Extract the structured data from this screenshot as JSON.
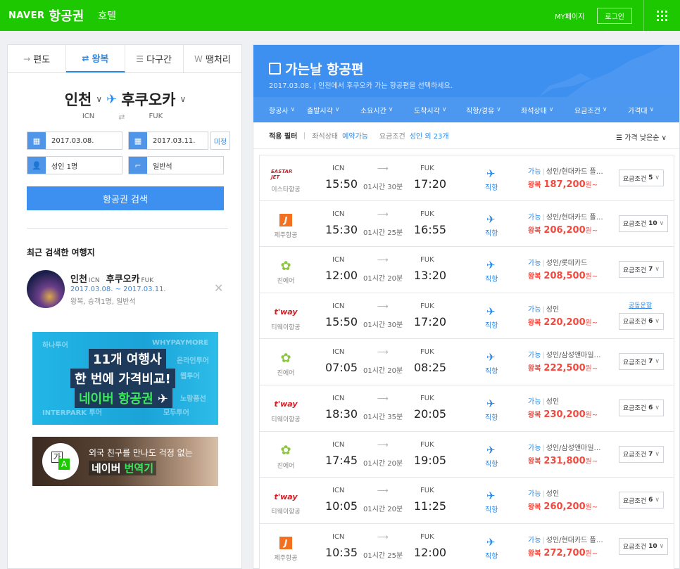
{
  "topbar": {
    "brand": "NAVER",
    "service": "항공권",
    "hotel": "호텔",
    "mypage": "MY페이지",
    "login": "로그인"
  },
  "left": {
    "tabs": [
      {
        "icon": "→",
        "label": "편도"
      },
      {
        "icon": "⇄",
        "label": "왕복"
      },
      {
        "icon": "☰",
        "label": "다구간"
      },
      {
        "icon": "W",
        "label": "땡처리"
      }
    ],
    "route": {
      "from": "인천",
      "from_code": "ICN",
      "to": "후쿠오카",
      "to_code": "FUK"
    },
    "depart_date": "2017.03.08.",
    "return_date": "2017.03.11.",
    "undecided": "미정",
    "passengers": "성인 1명",
    "seat_class": "일반석",
    "search_button": "항공권 검색",
    "recent_title": "최근 검색한 여행지",
    "recent": {
      "from": "인천",
      "from_code": "ICN",
      "to": "후쿠오카",
      "to_code": "FUK",
      "dates": "2017.03.08. ~ 2017.03.11.",
      "info": "왕복, 승객1명, 일반석"
    },
    "banner1": {
      "bg_texts": [
        "하나투어",
        "WHYPAYMORE",
        "온라인투어",
        "INTERPARK 투어",
        "모두투어",
        "웹투어",
        "노랑풍선"
      ],
      "line1": "11개 여행사",
      "line2": "한 번에 가격비교!",
      "line3_a": "네이버 ",
      "line3_b": "항공권"
    },
    "banner2": {
      "ga": "가",
      "a": "A",
      "line1": "외국 친구를 만나도 걱정 없는",
      "line2_a": "네이버 ",
      "line2_b": "번역기"
    }
  },
  "right": {
    "title": "가는날 항공편",
    "subtitle": "2017.03.08.  |  인천에서 후쿠오카 가는 항공편을 선택하세요.",
    "filters": [
      "항공사",
      "출발시각",
      "소요시간",
      "도착시각",
      "직항/경유",
      "좌석상태",
      "요금조건",
      "가격대"
    ],
    "applied_label": "적용 필터",
    "applied": [
      {
        "k": "좌석상태",
        "v": "예약가능"
      },
      {
        "k": "요금조건",
        "v": "성인 외 23개"
      }
    ],
    "sort": "가격 낮은순",
    "flights": [
      {
        "airline": "이스타항공",
        "logo": "EASTAR JET",
        "logo_type": "eastar",
        "dep_code": "ICN",
        "dep": "15:50",
        "dur": "01시간 30분",
        "arr_code": "FUK",
        "arr": "17:20",
        "stop": "직항",
        "status": "가능",
        "cond": "성인/현대카드 플…",
        "trip": "왕복",
        "price": "187,200",
        "won": "원~",
        "fare_label": "요금조건",
        "fare_count": "5",
        "share": ""
      },
      {
        "airline": "제주항공",
        "logo": "J",
        "logo_type": "jeju",
        "dep_code": "ICN",
        "dep": "15:30",
        "dur": "01시간 25분",
        "arr_code": "FUK",
        "arr": "16:55",
        "stop": "직항",
        "status": "가능",
        "cond": "성인/현대카드 플…",
        "trip": "왕복",
        "price": "206,200",
        "won": "원~",
        "fare_label": "요금조건",
        "fare_count": "10",
        "share": ""
      },
      {
        "airline": "진에어",
        "logo": "✿",
        "logo_type": "jin",
        "dep_code": "ICN",
        "dep": "12:00",
        "dur": "01시간 20분",
        "arr_code": "FUK",
        "arr": "13:20",
        "stop": "직항",
        "status": "가능",
        "cond": "성인/롯데카드",
        "trip": "왕복",
        "price": "208,500",
        "won": "원~",
        "fare_label": "요금조건",
        "fare_count": "7",
        "share": ""
      },
      {
        "airline": "티웨이항공",
        "logo": "t'way",
        "logo_type": "tway",
        "dep_code": "ICN",
        "dep": "15:50",
        "dur": "01시간 30분",
        "arr_code": "FUK",
        "arr": "17:20",
        "stop": "직항",
        "status": "가능",
        "cond": "성인",
        "trip": "왕복",
        "price": "220,200",
        "won": "원~",
        "fare_label": "요금조건",
        "fare_count": "6",
        "share": "공동운항"
      },
      {
        "airline": "진에어",
        "logo": "✿",
        "logo_type": "jin",
        "dep_code": "ICN",
        "dep": "07:05",
        "dur": "01시간 20분",
        "arr_code": "FUK",
        "arr": "08:25",
        "stop": "직항",
        "status": "가능",
        "cond": "성인/삼성앤마일…",
        "trip": "왕복",
        "price": "222,500",
        "won": "원~",
        "fare_label": "요금조건",
        "fare_count": "7",
        "share": ""
      },
      {
        "airline": "티웨이항공",
        "logo": "t'way",
        "logo_type": "tway",
        "dep_code": "ICN",
        "dep": "18:30",
        "dur": "01시간 35분",
        "arr_code": "FUK",
        "arr": "20:05",
        "stop": "직항",
        "status": "가능",
        "cond": "성인",
        "trip": "왕복",
        "price": "230,200",
        "won": "원~",
        "fare_label": "요금조건",
        "fare_count": "6",
        "share": ""
      },
      {
        "airline": "진에어",
        "logo": "✿",
        "logo_type": "jin",
        "dep_code": "ICN",
        "dep": "17:45",
        "dur": "01시간 20분",
        "arr_code": "FUK",
        "arr": "19:05",
        "stop": "직항",
        "status": "가능",
        "cond": "성인/삼성앤마일…",
        "trip": "왕복",
        "price": "231,800",
        "won": "원~",
        "fare_label": "요금조건",
        "fare_count": "7",
        "share": ""
      },
      {
        "airline": "티웨이항공",
        "logo": "t'way",
        "logo_type": "tway",
        "dep_code": "ICN",
        "dep": "10:05",
        "dur": "01시간 20분",
        "arr_code": "FUK",
        "arr": "11:25",
        "stop": "직항",
        "status": "가능",
        "cond": "성인",
        "trip": "왕복",
        "price": "260,200",
        "won": "원~",
        "fare_label": "요금조건",
        "fare_count": "6",
        "share": ""
      },
      {
        "airline": "제주항공",
        "logo": "J",
        "logo_type": "jeju",
        "dep_code": "ICN",
        "dep": "10:35",
        "dur": "01시간 25분",
        "arr_code": "FUK",
        "arr": "12:00",
        "stop": "직항",
        "status": "가능",
        "cond": "성인/현대카드 플…",
        "trip": "왕복",
        "price": "272,700",
        "won": "원~",
        "fare_label": "요금조건",
        "fare_count": "10",
        "share": ""
      }
    ]
  },
  "colors": {
    "naver_green": "#1ec800",
    "accent_blue": "#3d8ff0",
    "price_red": "#f2493e"
  }
}
